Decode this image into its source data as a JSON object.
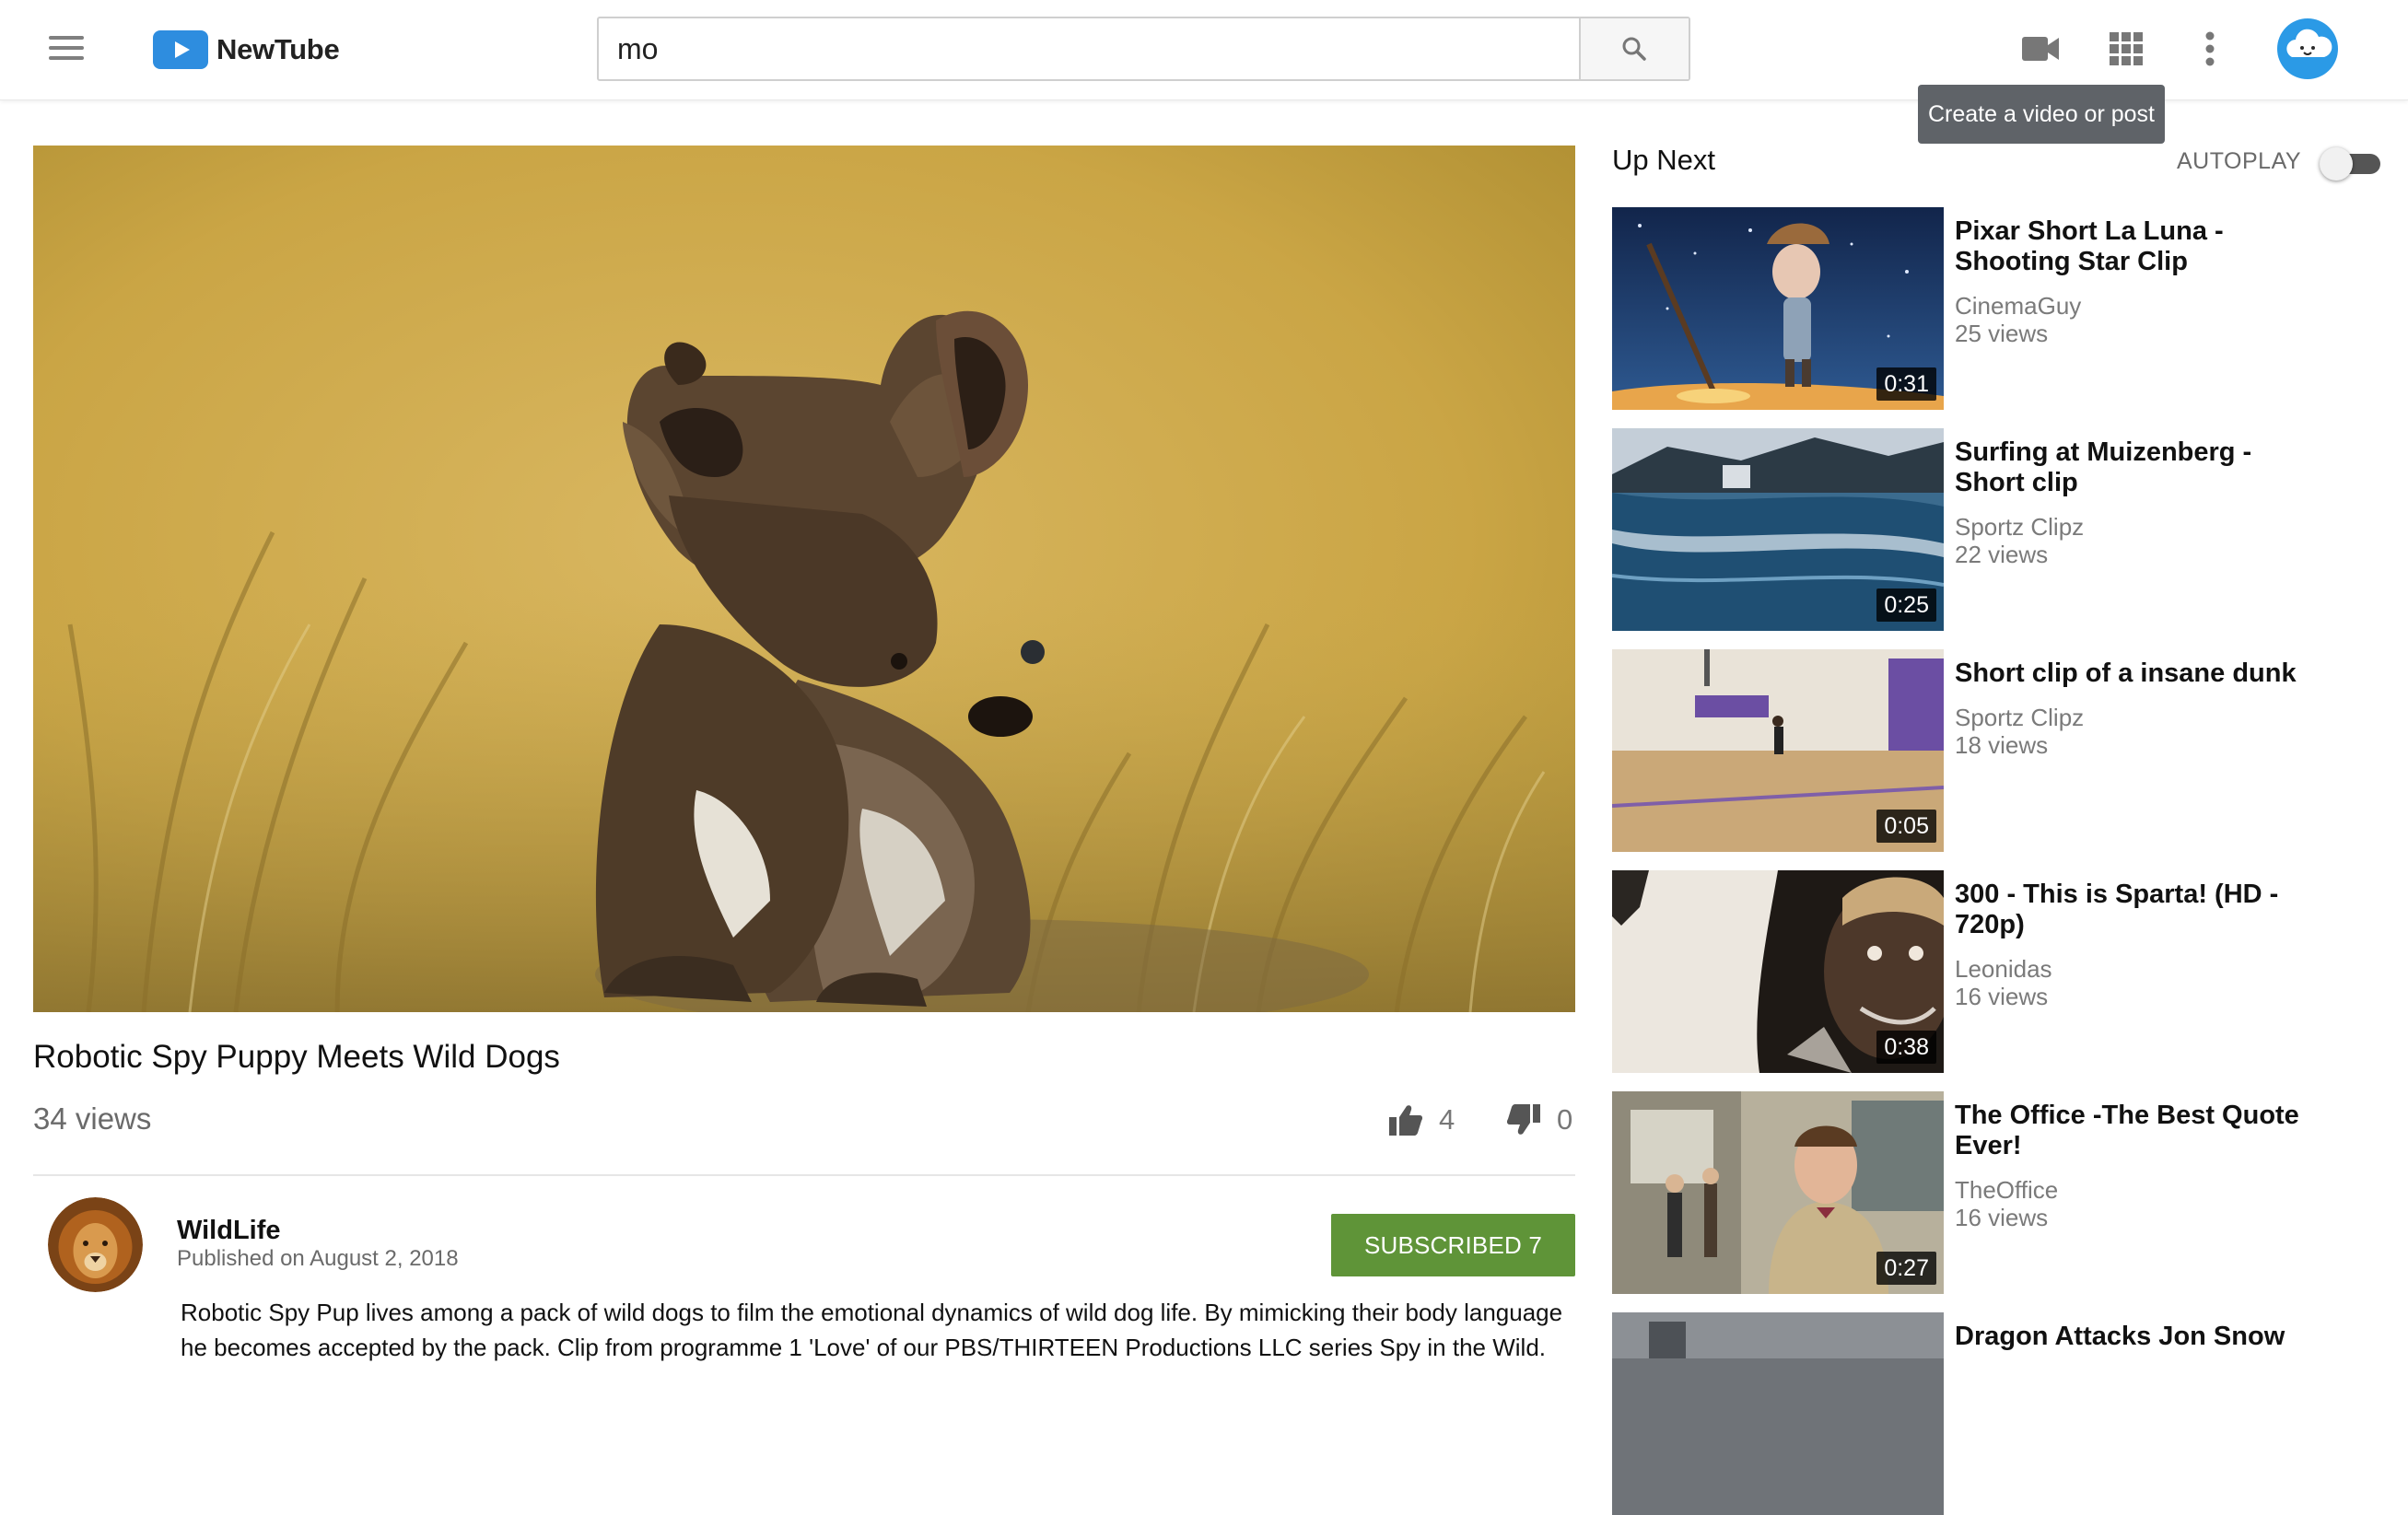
{
  "app": {
    "name": "NewTube"
  },
  "search": {
    "value": "mo",
    "placeholder": "Search"
  },
  "header": {
    "tooltip": "Create a video or post",
    "icons": [
      "menu-icon",
      "video-camera-icon",
      "apps-grid-icon",
      "more-vert-icon",
      "user-avatar"
    ]
  },
  "video": {
    "title": "Robotic Spy Puppy Meets Wild Dogs",
    "views": "34 views",
    "likes": "4",
    "dislikes": "0"
  },
  "channel": {
    "name": "WildLife",
    "published": "Published on August 2, 2018",
    "subscribe_label": "SUBSCRIBED 7"
  },
  "description": "Robotic Spy Pup lives among a pack of wild dogs to film the emotional dynamics of wild dog life. By mimicking their body language he becomes accepted by the pack.  Clip from programme 1 'Love' of our PBS/THIRTEEN Productions LLC series Spy in the Wild.",
  "sidebar": {
    "title": "Up Next",
    "autoplay_label": "AUTOPLAY",
    "autoplay_on": false,
    "items": [
      {
        "title": "Pixar Short La Luna - Shooting Star Clip",
        "channel": "CinemaGuy",
        "views": "25 views",
        "duration": "0:31"
      },
      {
        "title": "Surfing at Muizenberg - Short clip",
        "channel": "Sportz Clipz",
        "views": "22 views",
        "duration": "0:25"
      },
      {
        "title": "Short clip of a insane dunk",
        "channel": "Sportz Clipz",
        "views": "18 views",
        "duration": "0:05"
      },
      {
        "title": "300 - This is Sparta! (HD - 720p)",
        "channel": "Leonidas",
        "views": "16 views",
        "duration": "0:38"
      },
      {
        "title": "The Office -The Best Quote Ever!",
        "channel": "TheOffice",
        "views": "16 views",
        "duration": "0:27"
      },
      {
        "title": "Dragon Attacks Jon Snow",
        "channel": "",
        "views": "",
        "duration": ""
      }
    ]
  },
  "colors": {
    "brand": "#2e8ddf",
    "subscribe": "#5f9438",
    "tooltip": "#5f6368"
  }
}
